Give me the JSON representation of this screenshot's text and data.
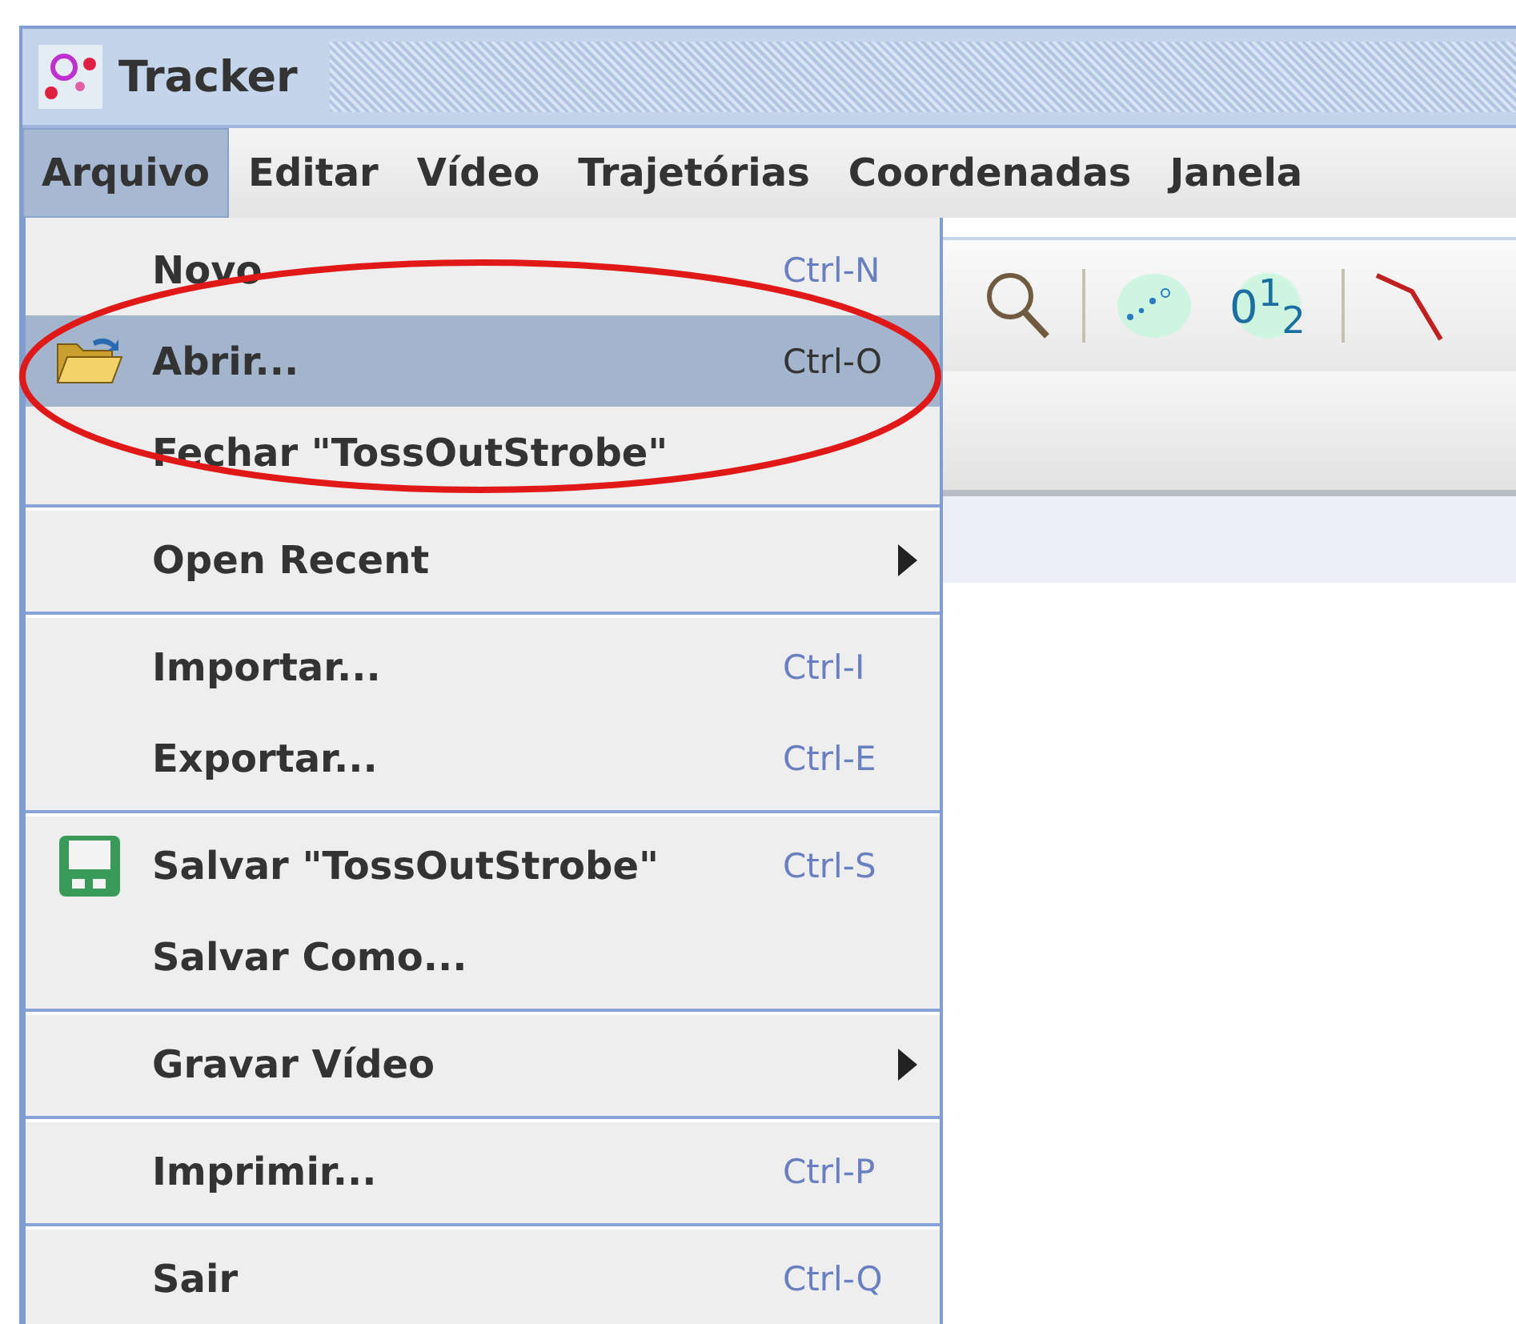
{
  "window": {
    "title": "Tracker"
  },
  "menu_bar": [
    {
      "label": "Arquivo",
      "selected": true
    },
    {
      "label": "Editar",
      "selected": false
    },
    {
      "label": "Vídeo",
      "selected": false
    },
    {
      "label": "Trajetórias",
      "selected": false
    },
    {
      "label": "Coordenadas",
      "selected": false
    },
    {
      "label": "Janela",
      "selected": false
    }
  ],
  "toolbar": [
    {
      "kind": "zoom"
    },
    {
      "kind": "separator"
    },
    {
      "kind": "points"
    },
    {
      "kind": "numbers",
      "label": "0$^{1}$$_{2}$"
    },
    {
      "kind": "separator"
    },
    {
      "kind": "line"
    }
  ],
  "menu": {
    "groups": [
      [
        {
          "kind": "command",
          "label": "Novo",
          "shortcut": "Ctrl-N",
          "selected": false
        },
        {
          "kind": "command-folder",
          "label": "Abrir...",
          "shortcut": "Ctrl-O",
          "selected": true
        },
        {
          "kind": "command",
          "label": "Fechar \"TossOutStrobe\"",
          "selected": false
        }
      ],
      [
        {
          "kind": "submenu",
          "label": "Open Recent",
          "selected": false
        }
      ],
      [
        {
          "kind": "command",
          "label": "Importar...",
          "shortcut": "Ctrl-I",
          "selected": false
        },
        {
          "kind": "command",
          "label": "Exportar...",
          "shortcut": "Ctrl-E",
          "selected": false
        }
      ],
      [
        {
          "kind": "command-save",
          "label": "Salvar \"TossOutStrobe\"",
          "shortcut": "Ctrl-S",
          "selected": false
        },
        {
          "kind": "command",
          "label": "Salvar Como...",
          "selected": false
        }
      ],
      [
        {
          "kind": "submenu",
          "label": "Gravar Vídeo",
          "selected": false
        }
      ],
      [
        {
          "kind": "command",
          "label": "Imprimir...",
          "shortcut": "Ctrl-P",
          "selected": false
        }
      ],
      [
        {
          "kind": "command",
          "label": "Sair",
          "shortcut": "Ctrl-Q",
          "selected": false
        }
      ]
    ]
  },
  "annotations": [
    {
      "kind": "ellipse"
    }
  ]
}
